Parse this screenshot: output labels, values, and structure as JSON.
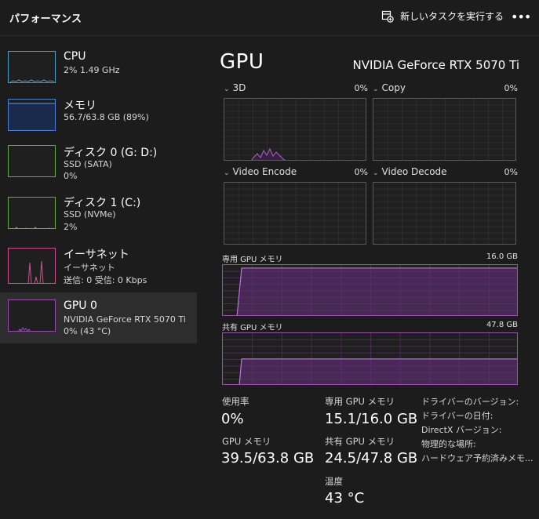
{
  "header": {
    "title": "パフォーマンス",
    "run_task_label": "新しいタスクを実行する",
    "more_label": "•••"
  },
  "sidebar": {
    "items": [
      {
        "name": "CPU",
        "sub1": "2%  1.49 GHz",
        "sub2": "",
        "sub3": "",
        "selected": false
      },
      {
        "name": "メモリ",
        "sub1": "56.7/63.8 GB (89%)",
        "sub2": "",
        "sub3": "",
        "selected": false
      },
      {
        "name": "ディスク 0 (G: D:)",
        "sub1": "SSD (SATA)",
        "sub2": "0%",
        "sub3": "",
        "selected": false
      },
      {
        "name": "ディスク 1 (C:)",
        "sub1": "SSD (NVMe)",
        "sub2": "2%",
        "sub3": "",
        "selected": false
      },
      {
        "name": "イーサネット",
        "sub1": "イーサネット",
        "sub2": "送信: 0 受信: 0 Kbps",
        "sub3": "",
        "selected": false
      },
      {
        "name": "GPU 0",
        "sub1": "NVIDIA GeForce RTX 5070 Ti",
        "sub2": "0%  (43 °C)",
        "sub3": "",
        "selected": true
      }
    ]
  },
  "main": {
    "title": "GPU",
    "model": "NVIDIA GeForce RTX 5070 Ti",
    "engines": [
      {
        "label": "3D",
        "percent": "0%"
      },
      {
        "label": "Copy",
        "percent": "0%"
      },
      {
        "label": "Video Encode",
        "percent": "0%"
      },
      {
        "label": "Video Decode",
        "percent": "0%"
      }
    ],
    "dedicated_memory": {
      "label": "専用 GPU メモリ",
      "capacity": "16.0 GB",
      "fill_fraction": 0.94
    },
    "shared_memory": {
      "label": "共有 GPU メモリ",
      "capacity": "47.8 GB",
      "fill_fraction": 0.51
    },
    "stats": {
      "utilization_label": "使用率",
      "utilization_value": "0%",
      "gpu_memory_label": "GPU メモリ",
      "gpu_memory_value": "39.5/63.8 GB",
      "dedicated_label": "専用 GPU メモリ",
      "dedicated_value": "15.1/16.0 GB",
      "shared_label": "共有 GPU メモリ",
      "shared_value": "24.5/47.8 GB",
      "temp_label": "温度",
      "temp_value": "43 °C"
    },
    "info": {
      "driver_version": "ドライバーのバージョン:",
      "driver_date": "ドライバーの日付:",
      "directx_version": "DirectX バージョン:",
      "physical_location": "物理的な場所:",
      "hw_reserved": "ハードウェア予約済みメモ..."
    }
  },
  "colors": {
    "background": "#1c1c1c",
    "gpu_accent": "#9a4fb0",
    "memory_accent": "#4f7fd1",
    "cpu_accent": "#3fa0c8",
    "disk_accent": "#5fae3f",
    "ethernet_accent": "#d04f93"
  }
}
